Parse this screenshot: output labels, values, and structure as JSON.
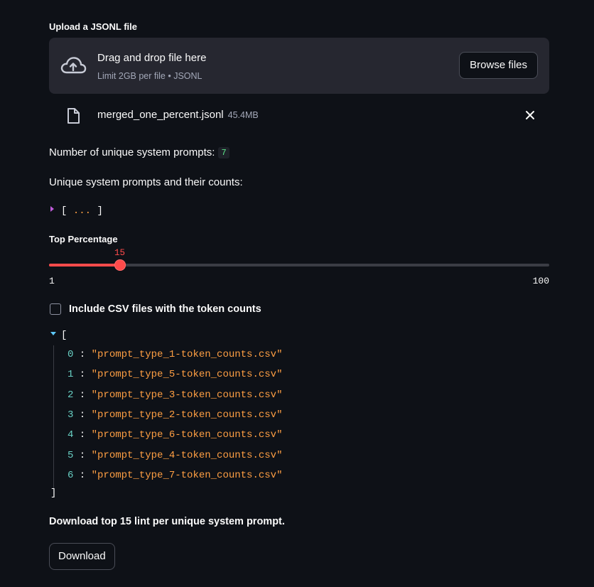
{
  "uploader": {
    "label": "Upload a JSONL file",
    "title": "Drag and drop file here",
    "limit": "Limit 2GB per file • JSONL",
    "browse_label": "Browse files",
    "cloud_icon": "cloud-upload-icon"
  },
  "file": {
    "name": "merged_one_percent.jsonl",
    "size": "45.4MB",
    "file_icon": "file-icon",
    "remove_icon": "close-icon"
  },
  "unique_count": {
    "label": "Number of unique system prompts:",
    "value": "7"
  },
  "prompts_heading": "Unique system prompts and their counts:",
  "collapsed_json": {
    "open": "[",
    "dots": "...",
    "close": "]"
  },
  "slider": {
    "label": "Top Percentage",
    "value": 15,
    "value_text": "15",
    "min": 1,
    "max": 100,
    "min_text": "1",
    "max_text": "100",
    "color": "#ff4b4b"
  },
  "checkbox": {
    "label": "Include CSV files with the token counts",
    "checked": false
  },
  "json_list": {
    "open": "[",
    "close": "]",
    "items": [
      {
        "index": "0",
        "value": "\"prompt_type_1-token_counts.csv\""
      },
      {
        "index": "1",
        "value": "\"prompt_type_5-token_counts.csv\""
      },
      {
        "index": "2",
        "value": "\"prompt_type_3-token_counts.csv\""
      },
      {
        "index": "3",
        "value": "\"prompt_type_2-token_counts.csv\""
      },
      {
        "index": "4",
        "value": "\"prompt_type_6-token_counts.csv\""
      },
      {
        "index": "5",
        "value": "\"prompt_type_4-token_counts.csv\""
      },
      {
        "index": "6",
        "value": "\"prompt_type_7-token_counts.csv\""
      }
    ]
  },
  "download": {
    "text": "Download top 15 lint per unique system prompt.",
    "button_label": "Download"
  }
}
